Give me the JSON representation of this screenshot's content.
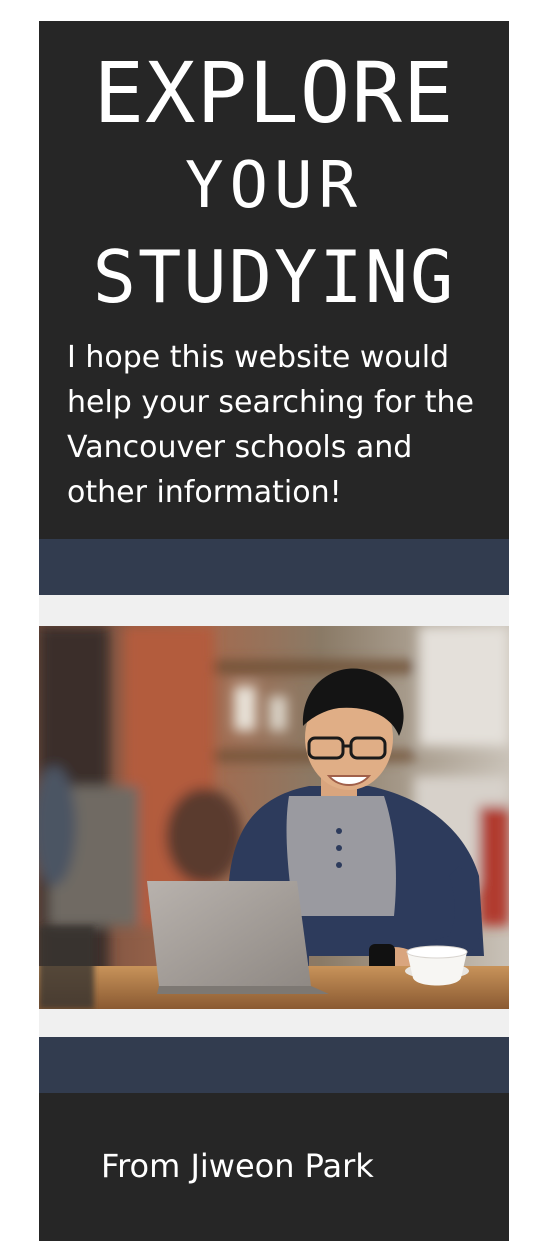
{
  "banner": {
    "title": {
      "line1": "EXPLORE",
      "line2": "YOUR",
      "line3": "STUDYING"
    },
    "intro_text": "I hope this website would help your searching for the Vancouver schools and other information!",
    "photo": {
      "alt": "Smiling student with laptop in a cafe"
    },
    "signature": "From Jiweon Park"
  },
  "colors": {
    "dark_panel": "#262626",
    "navy_band": "#323c4f",
    "light_gap": "#f0f0f0",
    "text": "#ffffff"
  }
}
